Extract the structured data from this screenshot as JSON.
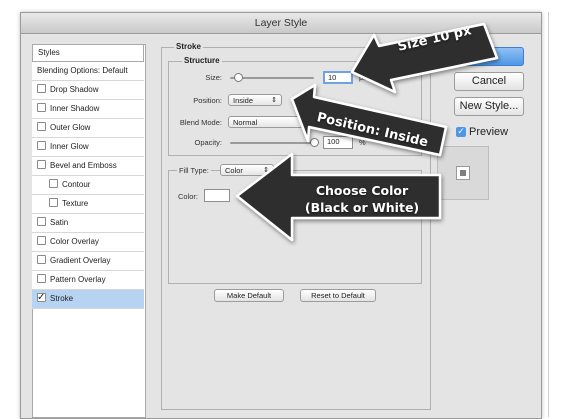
{
  "window": {
    "title": "Layer Style"
  },
  "sidebar": {
    "header": "Styles",
    "items": [
      {
        "label": "Blending Options: Default",
        "checkbox": false,
        "checked": false,
        "indent": false,
        "selected": false
      },
      {
        "label": "Drop Shadow",
        "checkbox": true,
        "checked": false,
        "indent": false,
        "selected": false
      },
      {
        "label": "Inner Shadow",
        "checkbox": true,
        "checked": false,
        "indent": false,
        "selected": false
      },
      {
        "label": "Outer Glow",
        "checkbox": true,
        "checked": false,
        "indent": false,
        "selected": false
      },
      {
        "label": "Inner Glow",
        "checkbox": true,
        "checked": false,
        "indent": false,
        "selected": false
      },
      {
        "label": "Bevel and Emboss",
        "checkbox": true,
        "checked": false,
        "indent": false,
        "selected": false
      },
      {
        "label": "Contour",
        "checkbox": true,
        "checked": false,
        "indent": true,
        "selected": false
      },
      {
        "label": "Texture",
        "checkbox": true,
        "checked": false,
        "indent": true,
        "selected": false
      },
      {
        "label": "Satin",
        "checkbox": true,
        "checked": false,
        "indent": false,
        "selected": false
      },
      {
        "label": "Color Overlay",
        "checkbox": true,
        "checked": false,
        "indent": false,
        "selected": false
      },
      {
        "label": "Gradient Overlay",
        "checkbox": true,
        "checked": false,
        "indent": false,
        "selected": false
      },
      {
        "label": "Pattern Overlay",
        "checkbox": true,
        "checked": false,
        "indent": false,
        "selected": false
      },
      {
        "label": "Stroke",
        "checkbox": true,
        "checked": true,
        "indent": false,
        "selected": true
      }
    ]
  },
  "stroke": {
    "legend": "Stroke",
    "structure_legend": "Structure",
    "size_label": "Size:",
    "size_value": "10",
    "size_unit": "px",
    "size_level": 0.1,
    "position_label": "Position:",
    "position_value": "Inside",
    "blend_mode_label": "Blend Mode:",
    "blend_mode_value": "Normal",
    "opacity_label": "Opacity:",
    "opacity_value": "100",
    "opacity_unit": "%",
    "opacity_level": 1.0,
    "fill_type_label": "Fill Type:",
    "fill_type_value": "Color",
    "color_label": "Color:",
    "make_default": "Make Default",
    "reset_default": "Reset to Default"
  },
  "buttons": {
    "ok": "OK",
    "cancel": "Cancel",
    "new_style": "New Style...",
    "preview_label": "Preview",
    "preview_checked": true
  },
  "annotations": {
    "size": "Size 10 px",
    "position": "Position: Inside",
    "color": "Choose Color (Black or White)"
  },
  "colors": {
    "callout_fill": "#2f2f2f",
    "selection": "#b7d3f2",
    "focus": "#6fa3e0",
    "primary_button": "#4f97e6"
  }
}
